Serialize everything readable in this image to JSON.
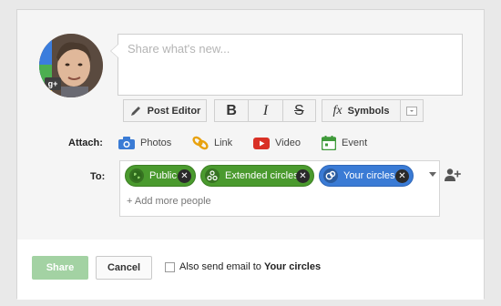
{
  "share": {
    "placeholder": "Share what's new..."
  },
  "avatar": {
    "badge": "g+"
  },
  "toolbar": {
    "post_editor_label": "Post Editor",
    "bold_glyph": "B",
    "italic_glyph": "I",
    "strike_glyph": "S",
    "symbols_label": "Symbols"
  },
  "attach": {
    "label": "Attach:",
    "items": [
      {
        "name": "photos",
        "label": "Photos",
        "icon": "camera-icon",
        "color": "#3a7bd5"
      },
      {
        "name": "link",
        "label": "Link",
        "icon": "link-icon",
        "color": "#e8a10c"
      },
      {
        "name": "video",
        "label": "Video",
        "icon": "youtube-icon",
        "color": "#d93025"
      },
      {
        "name": "event",
        "label": "Event",
        "icon": "calendar-icon",
        "color": "#3f9a3a"
      }
    ]
  },
  "to": {
    "label": "To:",
    "chips": [
      {
        "label": "Public",
        "icon": "globe-icon",
        "color": "#4a9a2e"
      },
      {
        "label": "Extended circles",
        "icon": "extended-circles-icon",
        "color": "#4a9a2e"
      },
      {
        "label": "Your circles",
        "icon": "circles-icon",
        "color": "#3a7bd5"
      }
    ],
    "add_more": "+ Add more people"
  },
  "footer": {
    "share_label": "Share",
    "cancel_label": "Cancel",
    "email_prefix": "Also send email to ",
    "email_target": "Your circles"
  }
}
